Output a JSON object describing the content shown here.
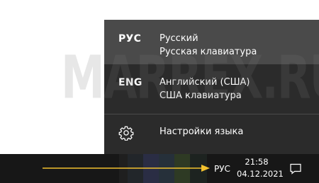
{
  "flyout": {
    "languages": [
      {
        "code": "РУС",
        "name": "Русский",
        "keyboard": "Русская клавиатура",
        "selected": true
      },
      {
        "code": "ENG",
        "name": "Английский (США)",
        "keyboard": "США клавиатура",
        "selected": false
      }
    ],
    "settings_label": "Настройки языка",
    "settings_icon": "gear-icon"
  },
  "taskbar": {
    "language_indicator": "РУС",
    "time": "21:58",
    "date": "04.12.2021",
    "notification_icon": "action-center-icon"
  },
  "watermark": "MARREX.RU",
  "colors": {
    "flyout_bg": "#2b2b2b",
    "selected_bg": "#4a4a4a",
    "taskbar_bg": "#171717",
    "arrow": "#f2c12e"
  }
}
